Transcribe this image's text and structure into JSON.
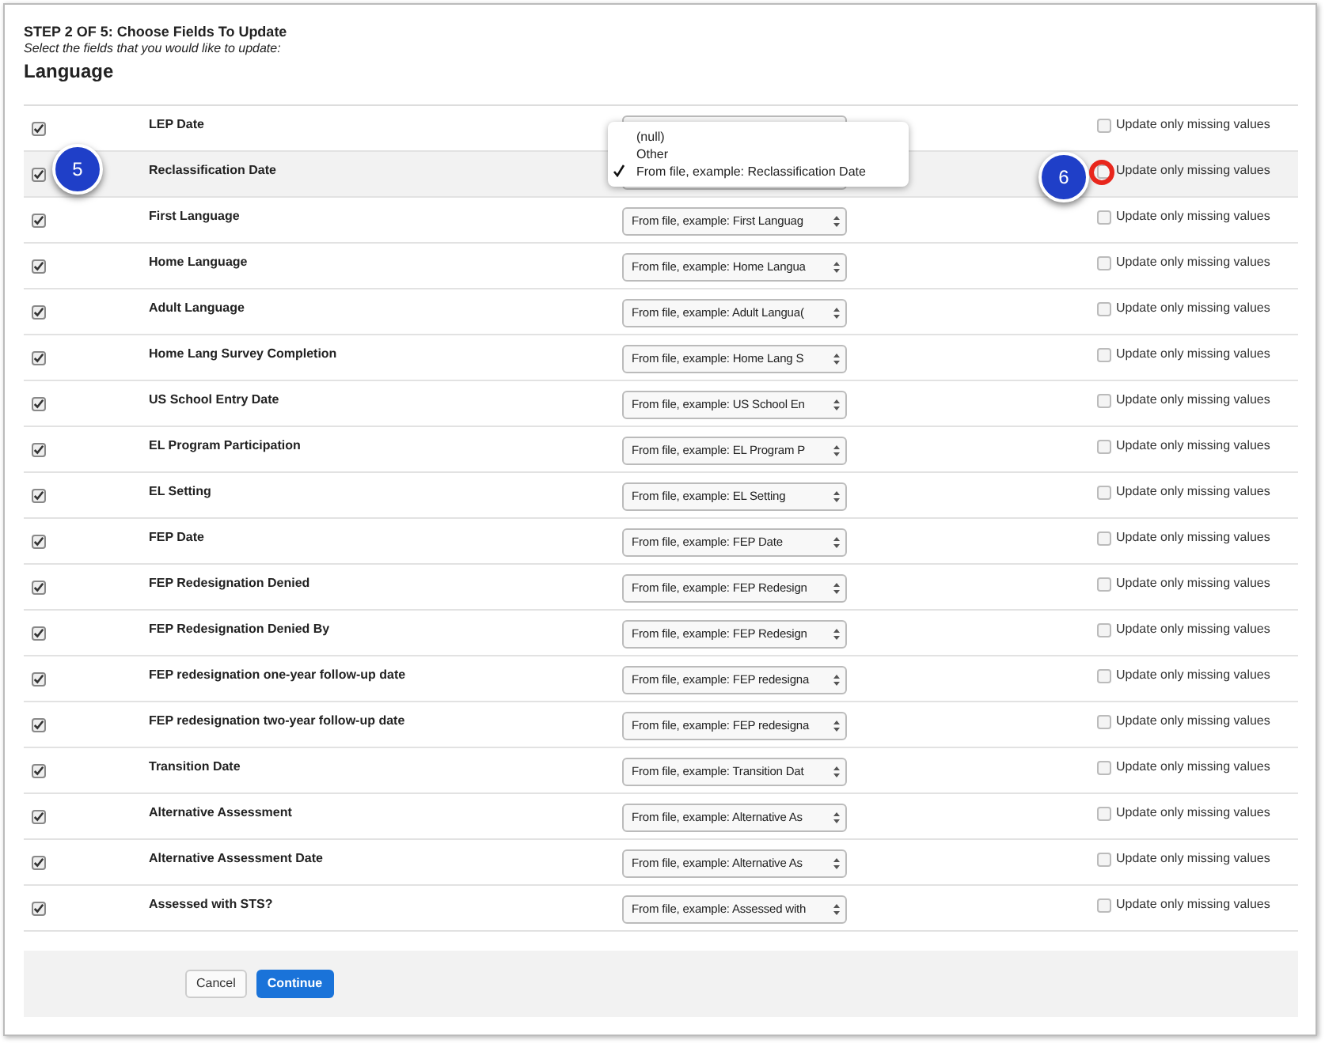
{
  "header": {
    "step": "STEP 2 OF 5: Choose Fields To Update",
    "instruction": "Select the fields that you would like to update:",
    "section": "Language"
  },
  "rows": [
    {
      "label": "LEP Date",
      "checked": true,
      "missing_label": "Update only missing values",
      "missing_checked": false,
      "highlighted": false
    },
    {
      "label": "Reclassification Date",
      "checked": true,
      "missing_label": "Update only missing values",
      "missing_checked": false,
      "highlighted": true
    },
    {
      "label": "First Language",
      "checked": true,
      "select": "From file, example: First Languag",
      "missing_label": "Update only missing values",
      "missing_checked": false,
      "highlighted": false
    },
    {
      "label": "Home Language",
      "checked": true,
      "select": "From file, example: Home Langua",
      "missing_label": "Update only missing values",
      "missing_checked": false,
      "highlighted": false
    },
    {
      "label": "Adult Language",
      "checked": true,
      "select": "From file, example: Adult Langua(",
      "missing_label": "Update only missing values",
      "missing_checked": false,
      "highlighted": false
    },
    {
      "label": "Home Lang Survey Completion",
      "checked": true,
      "select": "From file, example: Home Lang S",
      "missing_label": "Update only missing values",
      "missing_checked": false,
      "highlighted": false
    },
    {
      "label": "US School Entry Date",
      "checked": true,
      "select": "From file, example: US School En",
      "missing_label": "Update only missing values",
      "missing_checked": false,
      "highlighted": false
    },
    {
      "label": "EL Program Participation",
      "checked": true,
      "select": "From file, example: EL Program P",
      "missing_label": "Update only missing values",
      "missing_checked": false,
      "highlighted": false
    },
    {
      "label": "EL Setting",
      "checked": true,
      "select": "From file, example: EL Setting",
      "missing_label": "Update only missing values",
      "missing_checked": false,
      "highlighted": false
    },
    {
      "label": "FEP Date",
      "checked": true,
      "select": "From file, example: FEP Date",
      "missing_label": "Update only missing values",
      "missing_checked": false,
      "highlighted": false
    },
    {
      "label": "FEP Redesignation Denied",
      "checked": true,
      "select": "From file, example: FEP Redesign",
      "missing_label": "Update only missing values",
      "missing_checked": false,
      "highlighted": false
    },
    {
      "label": "FEP Redesignation Denied By",
      "checked": true,
      "select": "From file, example: FEP Redesign",
      "missing_label": "Update only missing values",
      "missing_checked": false,
      "highlighted": false
    },
    {
      "label": "FEP redesignation one-year follow-up date",
      "checked": true,
      "select": "From file, example: FEP redesigna",
      "missing_label": "Update only missing values",
      "missing_checked": false,
      "highlighted": false
    },
    {
      "label": "FEP redesignation two-year follow-up date",
      "checked": true,
      "select": "From file, example: FEP redesigna",
      "missing_label": "Update only missing values",
      "missing_checked": false,
      "highlighted": false
    },
    {
      "label": "Transition Date",
      "checked": true,
      "select": "From file, example: Transition Dat",
      "missing_label": "Update only missing values",
      "missing_checked": false,
      "highlighted": false
    },
    {
      "label": "Alternative Assessment",
      "checked": true,
      "select": "From file, example: Alternative As",
      "missing_label": "Update only missing values",
      "missing_checked": false,
      "highlighted": false
    },
    {
      "label": "Alternative Assessment Date",
      "checked": true,
      "select": "From file, example: Alternative As",
      "missing_label": "Update only missing values",
      "missing_checked": false,
      "highlighted": false
    },
    {
      "label": "Assessed with STS?",
      "checked": true,
      "select": "From file, example: Assessed with",
      "missing_label": "Update only missing values",
      "missing_checked": false,
      "highlighted": false
    }
  ],
  "dropdown": {
    "options": [
      {
        "label": "(null)",
        "selected": false
      },
      {
        "label": "Other",
        "selected": false
      },
      {
        "label": "From file, example: Reclassification Date",
        "selected": true
      }
    ]
  },
  "callouts": [
    "5",
    "6"
  ],
  "buttons": {
    "cancel": "Cancel",
    "continue": "Continue"
  }
}
